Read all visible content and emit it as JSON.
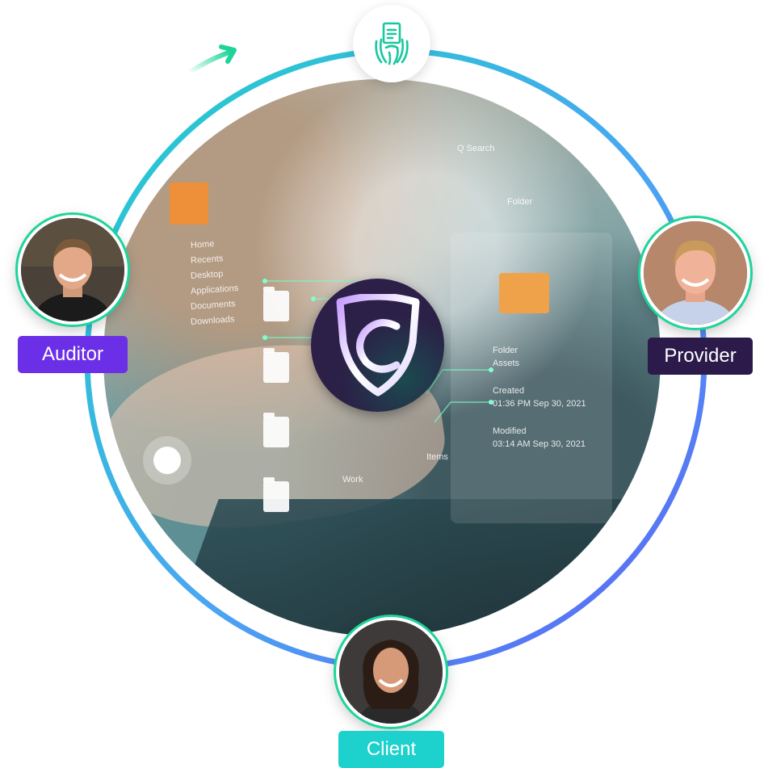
{
  "roles": {
    "auditor": "Auditor",
    "provider": "Provider",
    "client": "Client"
  },
  "background_ui": {
    "search": "Q Search",
    "folder_dropdown": "Folder",
    "sidebar": [
      "Home",
      "Recents",
      "Desktop",
      "Applications",
      "Documents",
      "Downloads"
    ],
    "details": [
      "Folder",
      "Assets",
      "Created",
      "01:36 PM Sep 30, 2021",
      "Modified",
      "03:14 AM Sep 30, 2021"
    ],
    "work_label": "Work",
    "items_label": "Items"
  },
  "icons": {
    "top_node": "fingerprint-document-icon",
    "center": "shield-c-logo-icon",
    "direction": "arrow-icon"
  },
  "colors": {
    "ring_start": "#1fd0c9",
    "ring_end": "#5e5ff5",
    "auditor_badge": "#6b2fe7",
    "provider_badge": "#2c1a4b",
    "client_badge": "#1dd1cc",
    "accent_green": "#1fd49a"
  }
}
